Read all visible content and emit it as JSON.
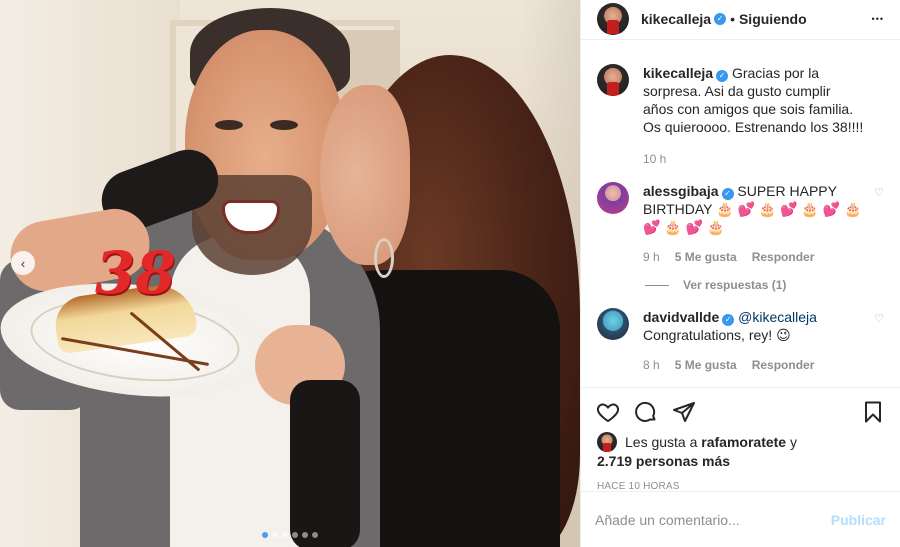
{
  "post": {
    "candle_text": "38",
    "carousel_prev_glyph": "‹",
    "carousel_dots": 6,
    "carousel_active": 0
  },
  "header": {
    "username": "kikecalleja",
    "separator": "•",
    "follow_status": "Siguiendo",
    "more_glyph": "•••"
  },
  "caption": {
    "username": "kikecalleja",
    "text": "Gracias por la sorpresa. Asi da gusto cumplir años con amigos que sois familia. Os quieroooo. Estrenando los 38!!!!",
    "time": "10 h"
  },
  "comments": [
    {
      "username": "alessgibaja",
      "text": "SUPER HAPPY BIRTHDAY 🎂 💕 🎂 💕 🎂 💕 🎂 💕 🎂 💕 🎂",
      "time": "9 h",
      "likes": "5 Me gusta",
      "reply": "Responder"
    },
    {
      "username": "davidvallde",
      "mention": "@kikecalleja",
      "text": "Congratulations, rey! 😉",
      "time": "8 h",
      "likes": "5 Me gusta",
      "reply": "Responder"
    }
  ],
  "view_replies": "Ver respuestas (1)",
  "likes": {
    "prefix": "Les gusta a",
    "user": "rafamoratete",
    "suffix": "y",
    "count": "2.719 personas más"
  },
  "time_ago": "HACE 10 HORAS",
  "add_comment": {
    "placeholder": "Añade un comentario...",
    "publish": "Publicar"
  },
  "icons": {
    "heart": "heart-icon",
    "comment": "comment-icon",
    "share": "share-icon",
    "save": "bookmark-icon",
    "verified": "verified-badge-icon"
  },
  "colors": {
    "verified": "#3897f0",
    "mention": "#00376b",
    "publish_disabled": "#b2dffc",
    "carousel_dot_active": "#4a9cf6"
  }
}
